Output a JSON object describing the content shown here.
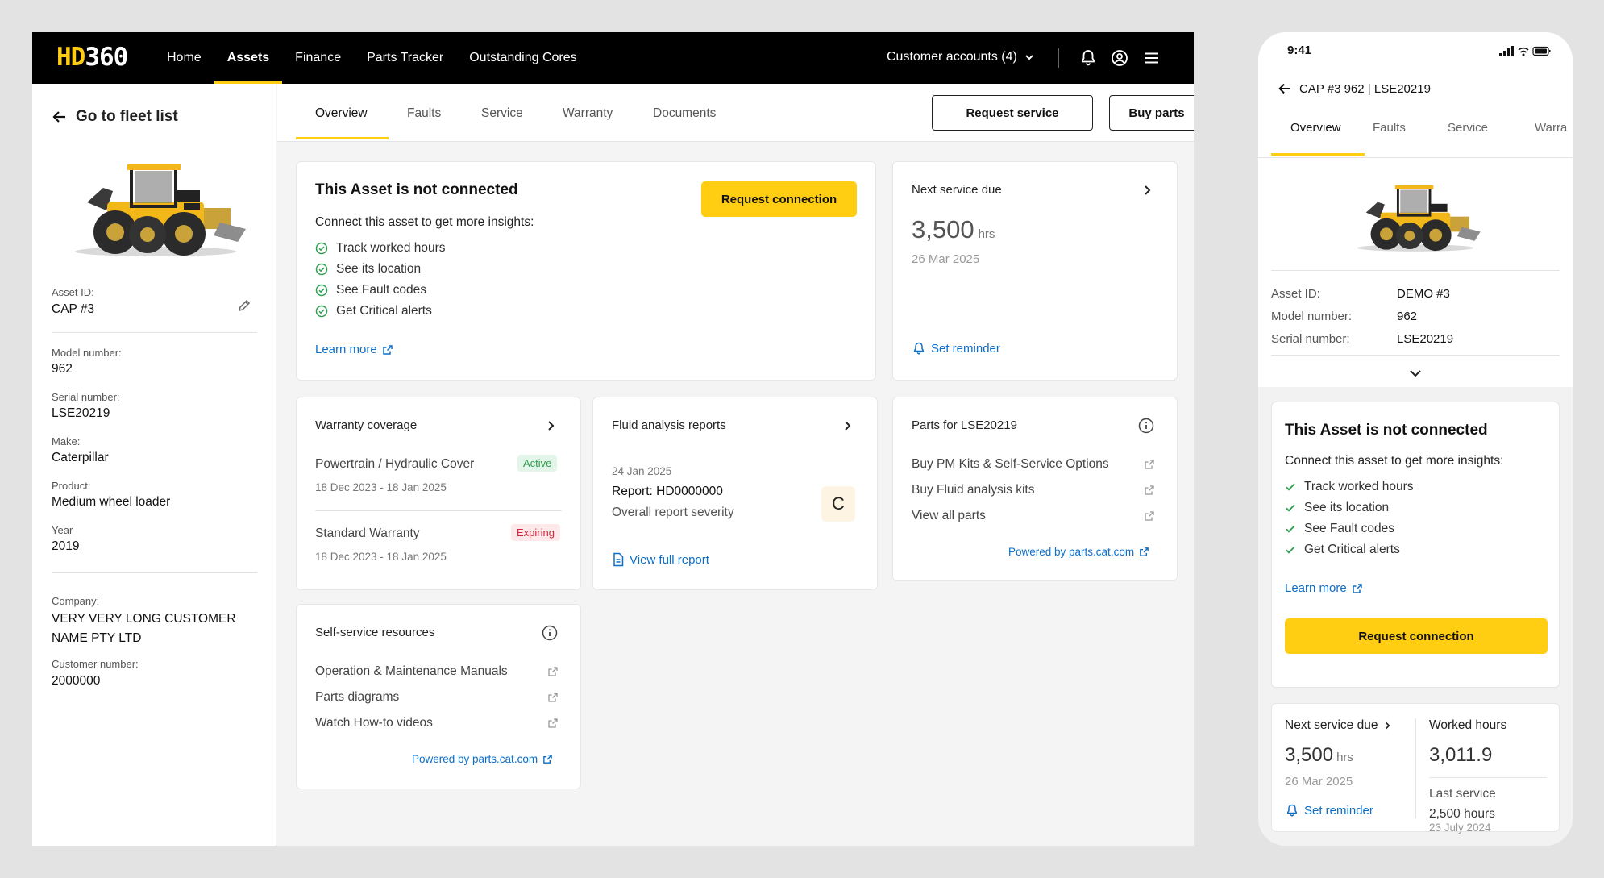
{
  "brand": {
    "prefix": "HD",
    "suffix": "360"
  },
  "nav": [
    {
      "label": "Home",
      "active": false
    },
    {
      "label": "Assets",
      "active": true
    },
    {
      "label": "Finance",
      "active": false
    },
    {
      "label": "Parts Tracker",
      "active": false
    },
    {
      "label": "Outstanding Cores",
      "active": false
    }
  ],
  "customer_accounts": "Customer accounts (4)",
  "sidebar": {
    "back_label": "Go to fleet list",
    "asset_id_label": "Asset ID:",
    "asset_id": "CAP #3",
    "model_label": "Model number:",
    "model": "962",
    "serial_label": "Serial number:",
    "serial": "LSE20219",
    "make_label": "Make:",
    "make": "Caterpillar",
    "product_label": "Product:",
    "product": "Medium wheel loader",
    "year_label": "Year",
    "year": "2019",
    "company_label": "Company:",
    "company_line1": "VERY VERY LONG CUSTOMER",
    "company_line2": "NAME PTY LTD",
    "customer_number_label": "Customer number:",
    "customer_number": "2000000"
  },
  "tabs": [
    "Overview",
    "Faults",
    "Service",
    "Warranty",
    "Documents"
  ],
  "actions": {
    "request_service": "Request service",
    "buy_parts": "Buy parts"
  },
  "connect_card": {
    "title": "This Asset is not connected",
    "button": "Request connection",
    "subtitle": "Connect this asset to get more insights:",
    "items": [
      "Track worked hours",
      "See its location",
      "See Fault codes",
      "Get Critical alerts"
    ],
    "learn_more": "Learn more"
  },
  "service_card": {
    "title": "Next service due",
    "value": "3,500",
    "unit": "hrs",
    "date": "26 Mar 2025",
    "reminder": "Set reminder"
  },
  "warranty_card": {
    "title": "Warranty coverage",
    "items": [
      {
        "name": "Powertrain / Hydraulic Cover",
        "status": "Active",
        "dates": "18 Dec 2023 - 18 Jan 2025"
      },
      {
        "name": "Standard Warranty",
        "status": "Expiring",
        "dates": "18 Dec 2023 - 18 Jan 2025"
      }
    ]
  },
  "fluid_card": {
    "title": "Fluid analysis reports",
    "date": "24 Jan 2025",
    "report": "Report: HD0000000",
    "severity_label": "Overall report severity",
    "grade": "C",
    "view_report": "View full report"
  },
  "parts_card": {
    "title": "Parts for LSE20219",
    "items": [
      "Buy PM Kits & Self-Service Options",
      "Buy Fluid analysis kits",
      "View all parts"
    ],
    "powered": "Powered by parts.cat.com"
  },
  "resources_card": {
    "title": "Self-service resources",
    "items": [
      "Operation & Maintenance Manuals",
      "Parts diagrams",
      "Watch How-to videos"
    ],
    "powered": "Powered by parts.cat.com"
  },
  "phone": {
    "time": "9:41",
    "header": "CAP #3 962 | LSE20219",
    "tabs": [
      "Overview",
      "Faults",
      "Service",
      "Warra"
    ],
    "asset_id_label": "Asset ID:",
    "asset_id": "DEMO #3",
    "model_label": "Model number:",
    "model": "962",
    "serial_label": "Serial number:",
    "serial": "LSE20219",
    "connect_title": "This Asset is not connected",
    "connect_subtitle": "Connect this asset to get more insights:",
    "items": [
      "Track worked hours",
      "See its location",
      "See Fault codes",
      "Get Critical alerts"
    ],
    "learn_more": "Learn more",
    "request_connection": "Request connection",
    "next_service_label": "Next service due",
    "next_service_value": "3,500",
    "next_service_unit": "hrs",
    "next_service_date": "26 Mar 2025",
    "reminder": "Set reminder",
    "worked_hours_label": "Worked hours",
    "worked_hours_value": "3,011.9",
    "last_service_label": "Last service",
    "last_service_value": "2,500 hours",
    "last_service_date": "23 July 2024"
  },
  "colors": {
    "accent": "#ffcd11",
    "link": "#0d6ec7",
    "success": "#2e9e4f",
    "danger": "#d0253b"
  }
}
